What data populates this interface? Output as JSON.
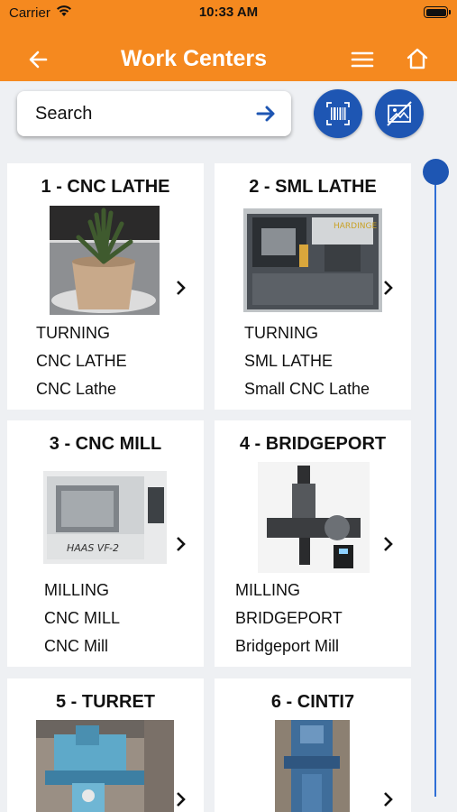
{
  "status_bar": {
    "carrier": "Carrier",
    "time": "10:33 AM"
  },
  "nav": {
    "title": "Work Centers"
  },
  "search": {
    "placeholder": "Search"
  },
  "scroll_slider": {
    "position_fraction": 0.0
  },
  "colors": {
    "header": "#f5891f",
    "accent": "#1e56b3",
    "background": "#eef0f3"
  },
  "work_centers": [
    {
      "title": "1 - CNC LATHE",
      "line1": "TURNING",
      "line2": "CNC LATHE",
      "line3": "CNC Lathe",
      "thumbnail": "potted-plant-photo"
    },
    {
      "title": "2 - SML LATHE",
      "line1": "TURNING",
      "line2": "SML LATHE",
      "line3": "Small CNC Lathe",
      "thumbnail": "small-lathe-photo"
    },
    {
      "title": "3 - CNC MILL",
      "line1": "MILLING",
      "line2": "CNC MILL",
      "line3": "CNC Mill",
      "thumbnail": "haas-vf2-mill-photo",
      "thumbnail_text": "HAAS VF-2"
    },
    {
      "title": "4 - BRIDGEPORT",
      "line1": "MILLING",
      "line2": "BRIDGEPORT",
      "line3": "Bridgeport Mill",
      "thumbnail": "bridgeport-machine-photo"
    },
    {
      "title": "5 - TURRET",
      "thumbnail": "turret-mill-photo"
    },
    {
      "title": "6 - CINTI7",
      "thumbnail": "cinti7-machine-photo"
    }
  ]
}
